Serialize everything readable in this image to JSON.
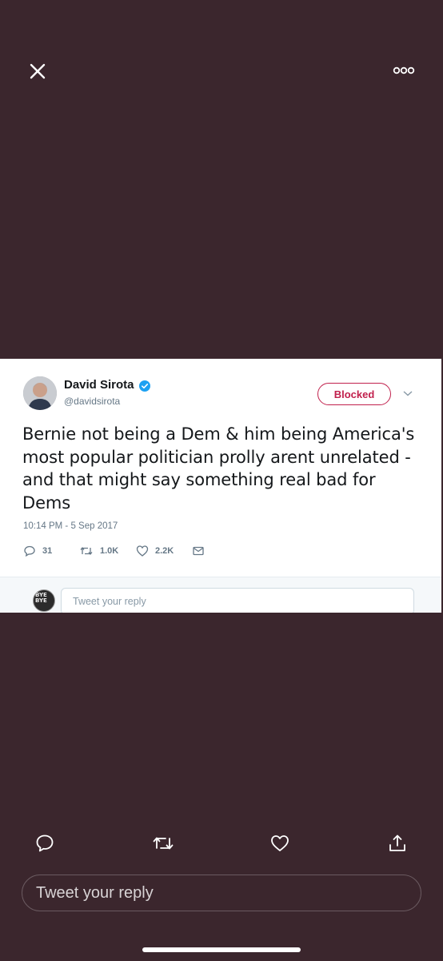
{
  "viewer": {
    "close_icon": "close-icon",
    "more_icon": "more-options-icon"
  },
  "tweet": {
    "author_name": "David Sirota",
    "handle": "@davidsirota",
    "verified": true,
    "follow_state_label": "Blocked",
    "text": "Bernie not being a Dem & him being America's most popular politician prolly arent unrelated - and that might say something real bad for Dems",
    "timestamp": "10:14 PM - 5 Sep 2017",
    "reply_count": "31",
    "retweet_count": "1.0K",
    "like_count": "2.2K",
    "reply_placeholder": "Tweet your reply",
    "reply_avatar_text": "BYE BYE"
  },
  "bottom_bar": {
    "actions": [
      "reply-icon",
      "retweet-icon",
      "like-icon",
      "share-icon"
    ],
    "reply_placeholder": "Tweet your reply"
  },
  "colors": {
    "background": "#3b262d",
    "blocked_accent": "#c1214d",
    "verified_blue": "#1da1f2"
  }
}
